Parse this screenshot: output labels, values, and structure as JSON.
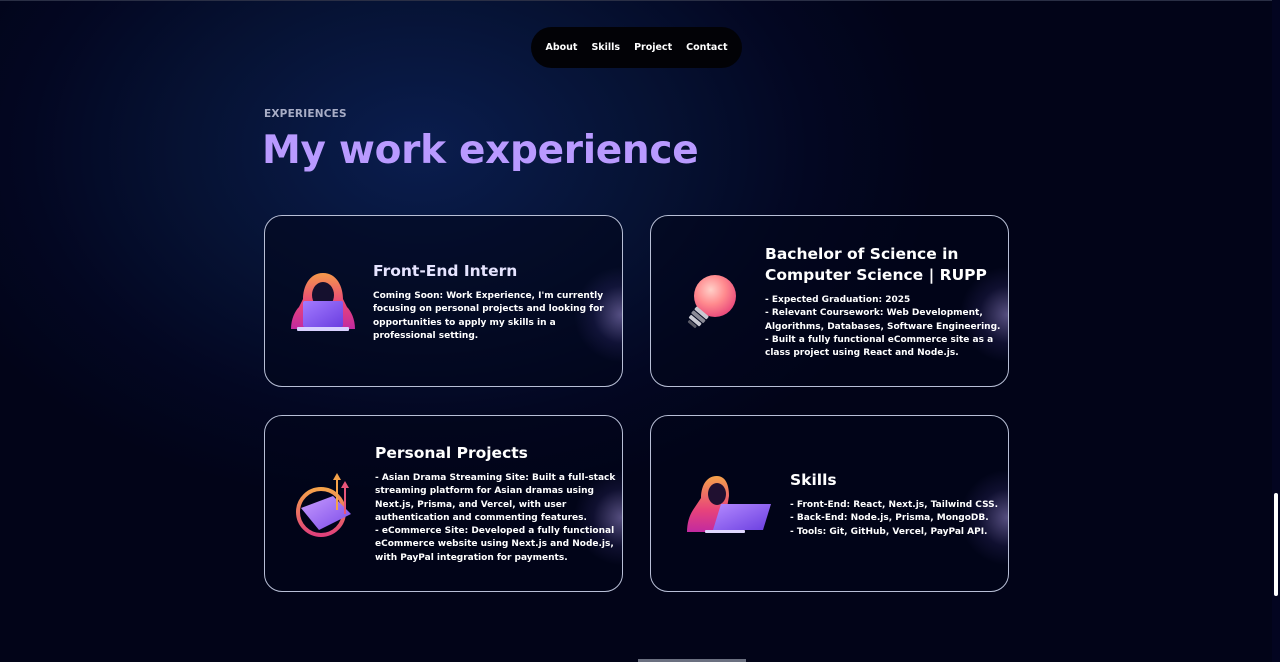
{
  "nav": {
    "items": [
      "About",
      "Skills",
      "Project",
      "Contact"
    ]
  },
  "section": {
    "eyebrow": "EXPERIENCES",
    "title": "My work experience"
  },
  "cards": [
    {
      "heading": [
        "Front-End Intern"
      ],
      "lines": [
        "Coming Soon: Work Experience, I'm currently",
        "focusing on personal projects and looking for",
        "opportunities to apply my skills in a",
        "professional setting."
      ],
      "icon": "hacker-laptop-icon"
    },
    {
      "heading": [
        "Bachelor of Science in",
        "Computer Science | RUPP"
      ],
      "lines": [
        "- Expected Graduation: 2025",
        "- Relevant Coursework: Web Development,",
        "Algorithms, Databases, Software Engineering.",
        "- Built a fully functional eCommerce site as a",
        "class project using React and Node.js."
      ],
      "icon": "lightbulb-icon"
    },
    {
      "heading": [
        "Personal Projects"
      ],
      "lines": [
        "- Asian Drama Streaming Site: Built a full-stack",
        "streaming platform for Asian dramas using",
        "Next.js, Prisma, and Vercel, with user",
        "authentication and commenting features.",
        "- eCommerce Site: Developed a fully functional",
        "eCommerce website using Next.js and Node.js,",
        "with PayPal integration for payments."
      ],
      "icon": "growth-chart-icon"
    },
    {
      "heading": [
        "Skills"
      ],
      "lines": [
        "- Front-End: React, Next.js, Tailwind CSS.",
        "- Back-End: Node.js, Prisma, MongoDB.",
        "- Tools: Git, GitHub, Vercel, PayPal API."
      ],
      "icon": "developer-laptop-icon"
    }
  ]
}
